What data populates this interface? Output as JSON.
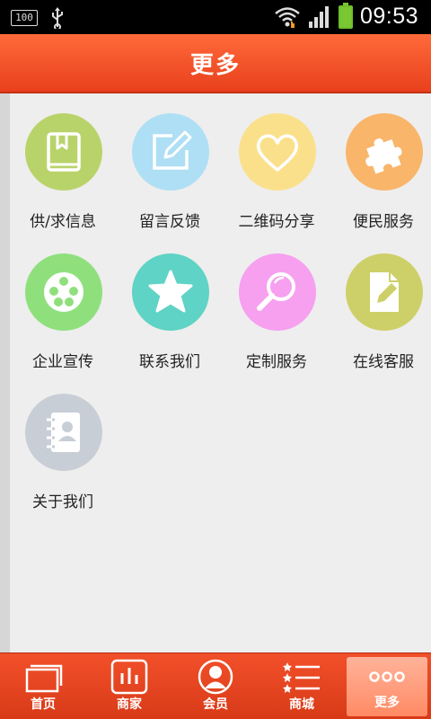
{
  "statusbar": {
    "battery_small_text": "100",
    "time": "09:53"
  },
  "header": {
    "title": "更多"
  },
  "grid": {
    "items": [
      {
        "label": "供/求信息",
        "icon": "book-icon",
        "color": "#b9d36b"
      },
      {
        "label": "留言反馈",
        "icon": "edit-icon",
        "color": "#aedff5"
      },
      {
        "label": "二维码分享",
        "icon": "heart-icon",
        "color": "#fbe08c"
      },
      {
        "label": "便民服务",
        "icon": "puzzle-icon",
        "color": "#f9b56a"
      },
      {
        "label": "企业宣传",
        "icon": "film-reel-icon",
        "color": "#8fe07d"
      },
      {
        "label": "联系我们",
        "icon": "star-icon",
        "color": "#5fd3c5"
      },
      {
        "label": "定制服务",
        "icon": "search-icon",
        "color": "#f6a0ef"
      },
      {
        "label": "在线客服",
        "icon": "document-pen-icon",
        "color": "#cdd068"
      },
      {
        "label": "关于我们",
        "icon": "contacts-book-icon",
        "color": "#c8ced6"
      }
    ]
  },
  "tabbar": {
    "tabs": [
      {
        "label": "首页",
        "icon": "home-windows-icon"
      },
      {
        "label": "商家",
        "icon": "bar-chart-icon"
      },
      {
        "label": "会员",
        "icon": "user-icon"
      },
      {
        "label": "商城",
        "icon": "star-list-icon"
      },
      {
        "label": "更多",
        "icon": "more-dots-icon",
        "active": true
      }
    ]
  }
}
